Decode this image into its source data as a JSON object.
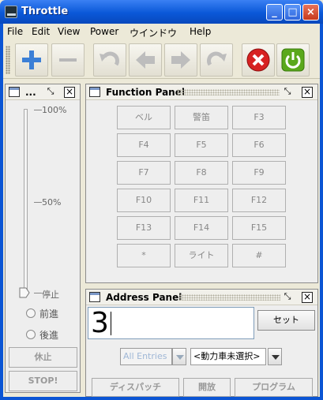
{
  "window": {
    "title": "Throttle"
  },
  "menu": [
    "File",
    "Edit",
    "View",
    "Power",
    "ウインドウ",
    "Help"
  ],
  "toolbar": {
    "icons": [
      "add-icon",
      "remove-icon",
      "undo-icon",
      "back-arrow-icon",
      "forward-arrow-icon",
      "redo-icon",
      "stop-icon",
      "power-icon"
    ],
    "colors": {
      "add": "#3b7fd6",
      "stop": "#d72222",
      "power": "#5aa81c"
    }
  },
  "control_panel": {
    "title": "...",
    "tick_labels": {
      "max": "100%",
      "mid": "50%",
      "min": "停止"
    },
    "speed_fraction": 0,
    "directions": [
      "前進",
      "後進"
    ],
    "idle_label": "休止",
    "stop_label": "STOP!"
  },
  "function_panel": {
    "title": "Function Panel",
    "buttons": [
      "ベル",
      "警笛",
      "F3",
      "F4",
      "F5",
      "F6",
      "F7",
      "F8",
      "F9",
      "F10",
      "F11",
      "F12",
      "F13",
      "F14",
      "F15",
      "*",
      "ライト",
      "#"
    ]
  },
  "address_panel": {
    "title": "Address Panel",
    "address_value": "3",
    "set_label": "セット",
    "roster_combo": "All Entries",
    "loco_combo": "<動力車未選択>",
    "bottom_buttons": [
      "ディスパッチ",
      "開放",
      "プログラム"
    ]
  }
}
